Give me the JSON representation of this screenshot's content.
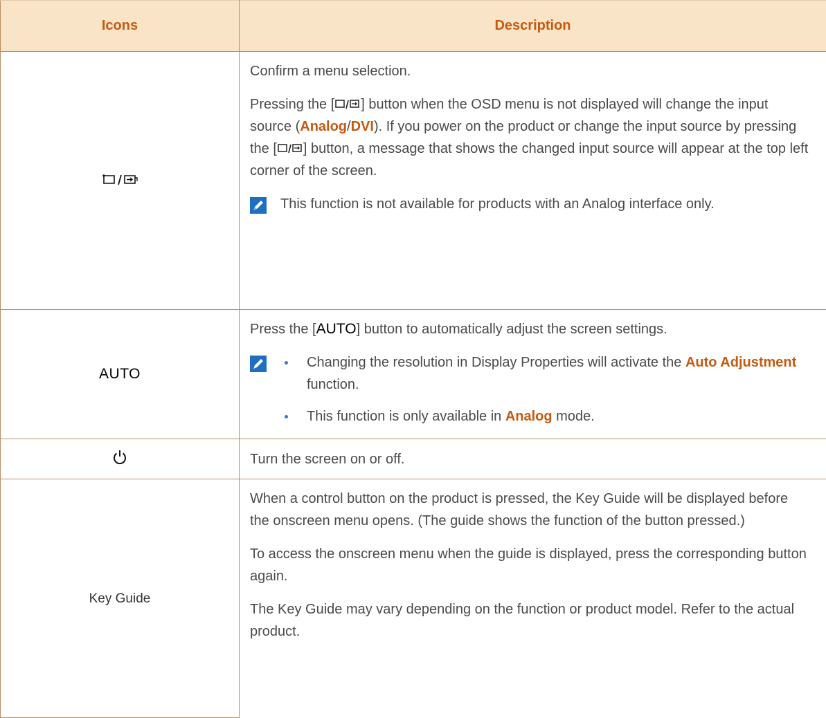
{
  "header": {
    "icons_label": "Icons",
    "description_label": "Description"
  },
  "rows": [
    {
      "icon": "source-enter-icon",
      "p1": "Confirm a menu selection.",
      "p2": {
        "a": "Pressing the [",
        "b": "] button when the OSD menu is not displayed will change the input source (",
        "analog": "Analog",
        "slash": "/",
        "dvi": "DVI",
        "c": "). If you power on the product or change the input source by pressing the [",
        "d": "] button, a message that shows the changed input source will appear at the top left corner of the screen."
      },
      "note": "This function is not available for products with an Analog interface only."
    },
    {
      "icon_text": "AUTO",
      "p1": {
        "a": "Press the [",
        "btn": "AUTO",
        "b": "] button to automatically adjust the screen settings."
      },
      "bullets": [
        {
          "a": "Changing the resolution in Display Properties will activate the ",
          "hl": "Auto Adjustment",
          "b": " function."
        },
        {
          "a": "This function is only available in ",
          "hl": "Analog",
          "b": " mode."
        }
      ]
    },
    {
      "icon": "power-icon",
      "text": "Turn the screen on or off."
    },
    {
      "icon_text": "Key Guide",
      "paragraphs": [
        "When a control button on the product is pressed, the Key Guide will be displayed before the onscreen menu opens. (The guide shows the function of the button pressed.)",
        "To access the onscreen menu when the guide is displayed, press the corresponding button again.",
        "The Key Guide may vary depending on the function or product model. Refer to the actual product."
      ]
    }
  ],
  "colors": {
    "header_bg": "#f9e4c8",
    "accent": "#c55a11",
    "border": "#b98d5f",
    "bullet": "#3b7bc8"
  }
}
